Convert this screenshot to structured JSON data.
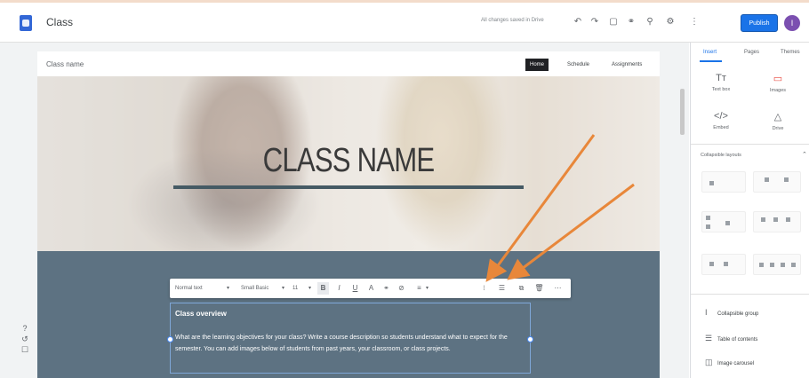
{
  "topbar": {
    "title": "Class",
    "saved_text": "All changes saved in Drive",
    "publish_label": "Publish",
    "avatar_letter": "I",
    "icons": [
      "undo-icon",
      "redo-icon",
      "preview-icon",
      "link-icon",
      "add-person-icon",
      "settings-icon",
      "more-vert-icon"
    ]
  },
  "site": {
    "name": "Class name",
    "nav": [
      {
        "label": "Home",
        "active": true
      },
      {
        "label": "Schedule",
        "active": false
      },
      {
        "label": "Assignments",
        "active": false
      }
    ],
    "hero_title": "CLASS NAME"
  },
  "formatting": {
    "style_label": "Normal text",
    "font_label": "Small Basic",
    "size_label": "11"
  },
  "textbox": {
    "heading": "Class overview",
    "body": "What are the learning objectives for your class? Write a course description so students understand what to expect for the semester. You can add images below of students from past years, your classroom, or class projects."
  },
  "panel": {
    "tabs": [
      "Insert",
      "Pages",
      "Themes"
    ],
    "insert_items": [
      {
        "label": "Text box",
        "icon": "text-box-icon"
      },
      {
        "label": "Images",
        "icon": "image-icon"
      },
      {
        "label": "Embed",
        "icon": "embed-icon"
      },
      {
        "label": "Drive",
        "icon": "drive-icon"
      }
    ],
    "layouts_title": "Collapsible layouts",
    "components": [
      {
        "label": "Collapsible group",
        "icon": "collapsible-icon"
      },
      {
        "label": "Table of contents",
        "icon": "toc-icon"
      },
      {
        "label": "Image carousel",
        "icon": "carousel-icon"
      }
    ]
  },
  "colors": {
    "accent": "#1a73e8",
    "section_bg": "#5d7282",
    "arrow": "#e8873a"
  }
}
